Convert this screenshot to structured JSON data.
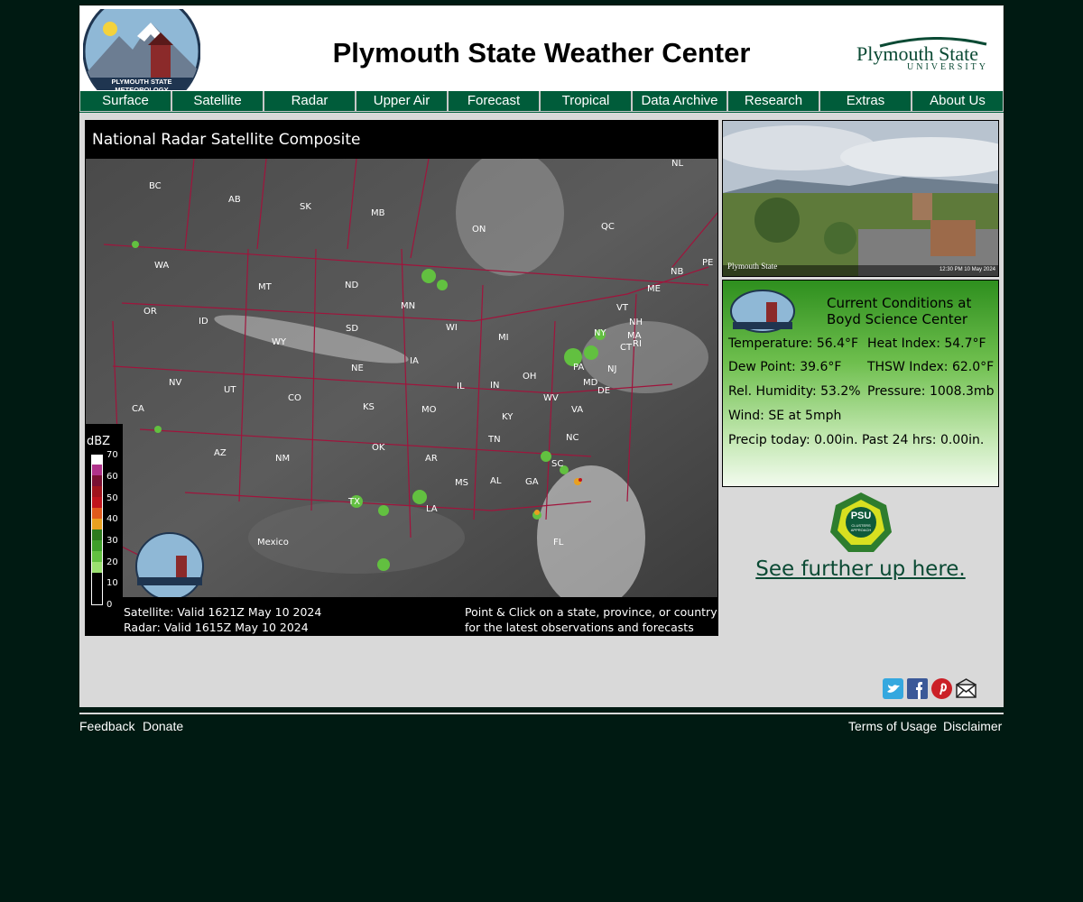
{
  "header": {
    "title": "Plymouth State Weather Center",
    "logo_text": "PLYMOUTH STATE METEOROLOGY",
    "university_name": "Plymouth State",
    "university_sub": "UNIVERSITY"
  },
  "nav": [
    {
      "label": "Surface"
    },
    {
      "label": "Satellite"
    },
    {
      "label": "Radar"
    },
    {
      "label": "Upper Air"
    },
    {
      "label": "Forecast"
    },
    {
      "label": "Tropical"
    },
    {
      "label": "Data Archive"
    },
    {
      "label": "Research"
    },
    {
      "label": "Extras"
    },
    {
      "label": "About Us"
    }
  ],
  "radar": {
    "title": "National Radar Satellite Composite",
    "satellite_valid": "Satellite: Valid 1621Z May 10 2024",
    "radar_valid": "Radar: Valid 1615Z May 10 2024",
    "click_line1": "Point & Click on a state, province, or country",
    "click_line2": "for the latest observations and forecasts",
    "legend_title": "dBZ",
    "legend_labels": [
      "70",
      "60",
      "50",
      "40",
      "30",
      "20",
      "10",
      "0"
    ],
    "legend_colors": [
      "#ffffff",
      "#b0328a",
      "#7a1032",
      "#c0141c",
      "#e05a1c",
      "#e8a020",
      "#2e7a1e",
      "#3f9f2a",
      "#62c040",
      "#9be070",
      "#000000"
    ],
    "regions": [
      "BC",
      "AB",
      "SK",
      "MB",
      "ON",
      "QC",
      "NL",
      "NB",
      "PE",
      "WA",
      "MT",
      "ND",
      "MN",
      "ME",
      "OR",
      "ID",
      "WY",
      "SD",
      "WI",
      "MI",
      "VT",
      "NH",
      "NY",
      "MA",
      "CT",
      "RI",
      "NV",
      "UT",
      "CO",
      "NE",
      "IA",
      "IL",
      "IN",
      "OH",
      "PA",
      "NJ",
      "CA",
      "KS",
      "MO",
      "KY",
      "WV",
      "MD",
      "DE",
      "VA",
      "AZ",
      "NM",
      "OK",
      "AR",
      "TN",
      "NC",
      "SC",
      "MS",
      "AL",
      "GA",
      "TX",
      "LA",
      "FL",
      "Mexico"
    ]
  },
  "webcam": {
    "caption_left": "Plymouth State",
    "caption_right": "12:30 PM 10 May 2024"
  },
  "conditions": {
    "heading_line1": "Current Conditions at",
    "heading_line2": "Boyd Science Center",
    "temperature": "Temperature: 56.4°F",
    "heat_index": "Heat Index: 54.7°F",
    "dew_point": "Dew Point: 39.6°F",
    "thsw_index": "THSW Index: 62.0°F",
    "humidity": "Rel. Humidity: 53.2%",
    "pressure": "Pressure: 1008.3mb",
    "wind": "Wind: SE at 5mph",
    "precip": "Precip today: 0.00in.  Past 24 hrs: 0.00in."
  },
  "promo": {
    "badge_line1": "PSU",
    "badge_line2": "CLUSTERS APPROACH",
    "link": "See further up here."
  },
  "social": [
    "twitter-icon",
    "facebook-icon",
    "pinterest-icon",
    "email-icon"
  ],
  "footer": {
    "feedback": "Feedback",
    "donate": "Donate",
    "terms": "Terms of Usage",
    "disclaimer": "Disclaimer"
  }
}
